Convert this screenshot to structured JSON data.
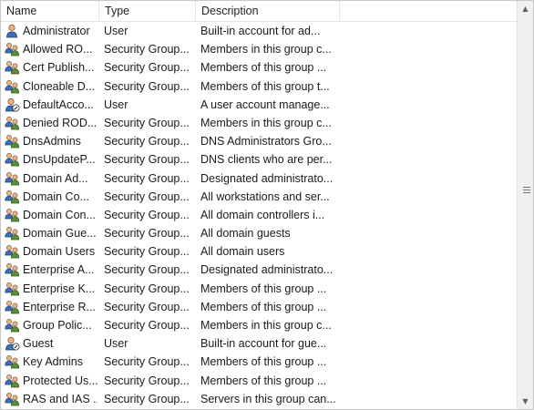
{
  "columns": {
    "name": "Name",
    "type": "Type",
    "description": "Description"
  },
  "rows": [
    {
      "name": "Administrator",
      "type": "User",
      "description": "Built-in account for ad...",
      "icon": "user-icon"
    },
    {
      "name": "Allowed RO...",
      "type": "Security Group...",
      "description": "Members in this group c...",
      "icon": "group-icon"
    },
    {
      "name": "Cert Publish...",
      "type": "Security Group...",
      "description": "Members of this group ...",
      "icon": "group-icon"
    },
    {
      "name": "Cloneable D...",
      "type": "Security Group...",
      "description": "Members of this group t...",
      "icon": "group-icon"
    },
    {
      "name": "DefaultAcco...",
      "type": "User",
      "description": "A user account manage...",
      "icon": "disabled-user-icon"
    },
    {
      "name": "Denied ROD...",
      "type": "Security Group...",
      "description": "Members in this group c...",
      "icon": "group-icon"
    },
    {
      "name": "DnsAdmins",
      "type": "Security Group...",
      "description": "DNS Administrators Gro...",
      "icon": "group-icon"
    },
    {
      "name": "DnsUpdateP...",
      "type": "Security Group...",
      "description": "DNS clients who are per...",
      "icon": "group-icon"
    },
    {
      "name": "Domain Ad...",
      "type": "Security Group...",
      "description": "Designated administrato...",
      "icon": "group-icon"
    },
    {
      "name": "Domain Co...",
      "type": "Security Group...",
      "description": "All workstations and ser...",
      "icon": "group-icon"
    },
    {
      "name": "Domain Con...",
      "type": "Security Group...",
      "description": "All domain controllers i...",
      "icon": "group-icon"
    },
    {
      "name": "Domain Gue...",
      "type": "Security Group...",
      "description": "All domain guests",
      "icon": "group-icon"
    },
    {
      "name": "Domain Users",
      "type": "Security Group...",
      "description": "All domain users",
      "icon": "group-icon"
    },
    {
      "name": "Enterprise A...",
      "type": "Security Group...",
      "description": "Designated administrato...",
      "icon": "group-icon"
    },
    {
      "name": "Enterprise K...",
      "type": "Security Group...",
      "description": "Members of this group ...",
      "icon": "group-icon"
    },
    {
      "name": "Enterprise R...",
      "type": "Security Group...",
      "description": "Members of this group ...",
      "icon": "group-icon"
    },
    {
      "name": "Group Polic...",
      "type": "Security Group...",
      "description": "Members in this group c...",
      "icon": "group-icon"
    },
    {
      "name": "Guest",
      "type": "User",
      "description": "Built-in account for gue...",
      "icon": "disabled-user-icon"
    },
    {
      "name": "Key Admins",
      "type": "Security Group...",
      "description": "Members of this group ...",
      "icon": "group-icon"
    },
    {
      "name": "Protected Us...",
      "type": "Security Group...",
      "description": "Members of this group ...",
      "icon": "group-icon"
    },
    {
      "name": "RAS and IAS ...",
      "type": "Security Group...",
      "description": "Servers in this group can...",
      "icon": "group-icon"
    }
  ],
  "scrollbar": {
    "up_arrow": "▲",
    "down_arrow": "▼"
  }
}
